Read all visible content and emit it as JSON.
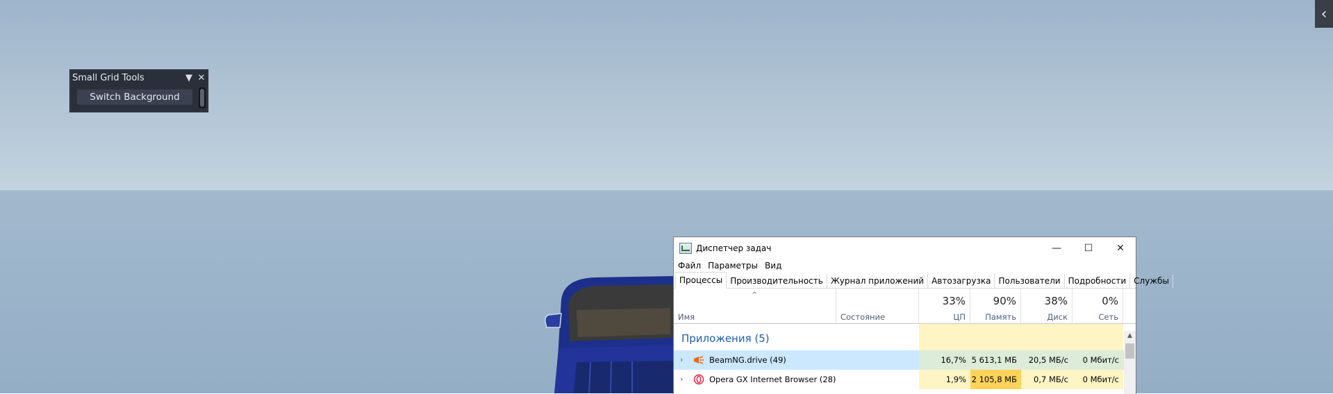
{
  "edge_tab": {
    "icon": "chevron-left-icon",
    "glyph": "‹"
  },
  "small_grid_tools": {
    "title": "Small Grid Tools",
    "dropdown_icon": "▼",
    "close_icon": "✕",
    "switch_button": "Switch Background"
  },
  "task_manager": {
    "title": "Диспетчер задач",
    "window_controls": {
      "minimize": "—",
      "maximize": "☐",
      "close": "✕"
    },
    "menu": [
      "Файл",
      "Параметры",
      "Вид"
    ],
    "tabs": [
      "Процессы",
      "Производительность",
      "Журнал приложений",
      "Автозагрузка",
      "Пользователи",
      "Подробности",
      "Службы"
    ],
    "active_tab": "Процессы",
    "sort_arrow": "^",
    "columns": {
      "name": "Имя",
      "status": "Состояние",
      "cpu": {
        "pct": "33%",
        "label": "ЦП"
      },
      "memory": {
        "pct": "90%",
        "label": "Память"
      },
      "disk": {
        "pct": "38%",
        "label": "Диск"
      },
      "network": {
        "pct": "0%",
        "label": "Сеть"
      }
    },
    "group_title": "Приложения (5)",
    "rows": [
      {
        "name": "BeamNG.drive (49)",
        "status": "",
        "cpu": "16,7%",
        "memory": "5 613,1 МБ",
        "disk": "20,5 МБ/с",
        "network": "0 Мбит/с",
        "icon": "beamng-icon"
      },
      {
        "name": "Opera GX Internet Browser (28)",
        "status": "",
        "cpu": "1,9%",
        "memory": "2 105,8 МБ",
        "disk": "0,7 МБ/с",
        "network": "0 Мбит/с",
        "icon": "opera-gx-icon"
      }
    ],
    "colors": {
      "selected_row": "#cce8ff",
      "cell_light": "#fff4c4",
      "cell_memory_high": "#ffd35a",
      "group_blue": "#1f5fb4"
    }
  }
}
